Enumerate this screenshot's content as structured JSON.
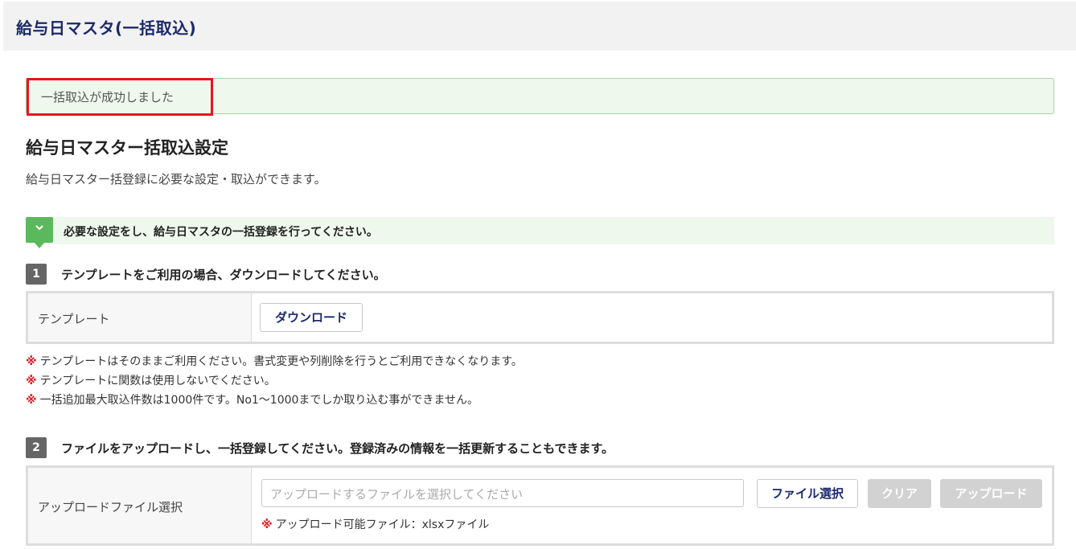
{
  "header": {
    "title": "給与日マスタ(一括取込)"
  },
  "alert": {
    "message": "一括取込が成功しました",
    "highlight_color": "#e8151c",
    "background_color": "#eef8ec"
  },
  "main": {
    "title": "給与日マスター括取込設定",
    "description": "給与日マスター括登録に必要な設定・取込ができます。"
  },
  "info": {
    "icon": "chevron-down-icon",
    "text": "必要な設定をし、給与日マスタの一括登録を行ってください。"
  },
  "step1": {
    "number": "1",
    "label": "テンプレートをご利用の場合、ダウンロードしてください。",
    "row_label": "テンプレート",
    "download_button": "ダウンロード"
  },
  "notes": {
    "mark": "※",
    "items": [
      "テンプレートはそのままご利用ください。書式変更や列削除を行うとご利用できなくなります。",
      "テンプレートに関数は使用しないでください。",
      "一括追加最大取込件数は1000件です。No1～1000までしか取り込む事ができません。"
    ]
  },
  "step2": {
    "number": "2",
    "label": "ファイルをアップロードし、一括登録してください。登録済みの情報を一括更新することもできます。",
    "row_label": "アップロードファイル選択",
    "file_placeholder": "アップロードするファイルを選択してください",
    "select_button": "ファイル選択",
    "clear_button": "クリア",
    "upload_button": "アップロード",
    "note_mark": "※",
    "note": "アップロード可能ファイル：xlsxファイル"
  },
  "colors": {
    "accent_navy": "#1b2a6b",
    "success_green": "#5cb85c",
    "warning_red": "#e8151c"
  }
}
